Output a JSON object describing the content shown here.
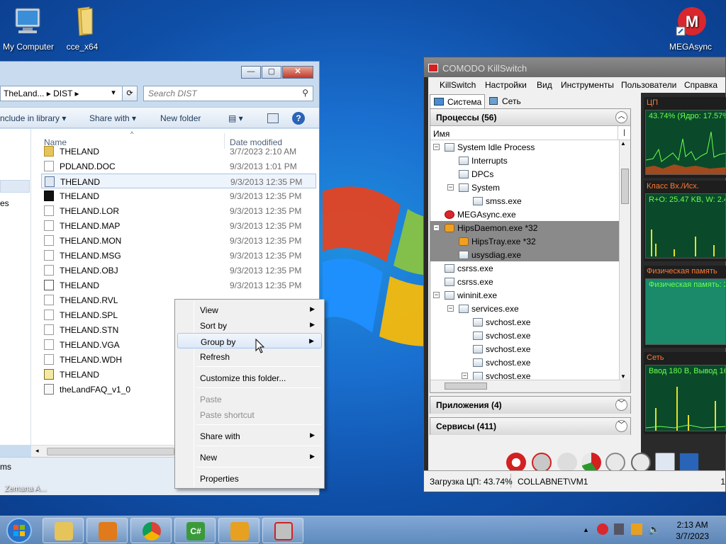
{
  "desktop": {
    "icons": [
      {
        "label": "My Computer",
        "icon": "computer-icon"
      },
      {
        "label": "cce_x64",
        "icon": "folder-icon"
      },
      {
        "label": "MEGAsync",
        "icon": "megasync-icon"
      }
    ],
    "truncated_label": "Zemana A..."
  },
  "explorer": {
    "breadcrumb": [
      "TheLand...",
      "DIST"
    ],
    "search_placeholder": "Search DIST",
    "toolbar": {
      "include": "nclude in library",
      "share": "Share with",
      "new_folder": "New folder"
    },
    "columns": {
      "name": "Name",
      "date": "Date modified"
    },
    "nav_partial": [
      "es",
      "ms"
    ],
    "files": [
      {
        "name": "THELAND",
        "date": "3/7/2023 2:10 AM",
        "icon": "folder-icon"
      },
      {
        "name": "PDLAND.DOC",
        "date": "9/3/2013 1:01 PM",
        "icon": "file-icon"
      },
      {
        "name": "THELAND",
        "date": "9/3/2013 12:35 PM",
        "icon": "app-icon"
      },
      {
        "name": "THELAND",
        "date": "9/3/2013 12:35 PM",
        "icon": "exe-icon"
      },
      {
        "name": "THELAND.LOR",
        "date": "9/3/2013 12:35 PM",
        "icon": "file-icon"
      },
      {
        "name": "THELAND.MAP",
        "date": "9/3/2013 12:35 PM",
        "icon": "file-icon"
      },
      {
        "name": "THELAND.MON",
        "date": "9/3/2013 12:35 PM",
        "icon": "file-icon"
      },
      {
        "name": "THELAND.MSG",
        "date": "9/3/2013 12:35 PM",
        "icon": "file-icon"
      },
      {
        "name": "THELAND.OBJ",
        "date": "9/3/2013 12:35 PM",
        "icon": "file-icon"
      },
      {
        "name": "THELAND",
        "date": "9/3/2013 12:35 PM",
        "icon": "shortcut-icon"
      },
      {
        "name": "THELAND.RVL",
        "date": "",
        "icon": "file-icon"
      },
      {
        "name": "THELAND.SPL",
        "date": "",
        "icon": "file-icon"
      },
      {
        "name": "THELAND.STN",
        "date": "",
        "icon": "file-icon"
      },
      {
        "name": "THELAND.VGA",
        "date": "",
        "icon": "file-icon"
      },
      {
        "name": "THELAND.WDH",
        "date": "",
        "icon": "file-icon"
      },
      {
        "name": "THELAND",
        "date": "",
        "icon": "config-icon"
      },
      {
        "name": "theLandFAQ_v1_0",
        "date": "",
        "icon": "text-file-icon"
      }
    ]
  },
  "context_menu": {
    "items": [
      "View",
      "Sort by",
      "Group by",
      "Refresh",
      "Customize this folder...",
      "Paste",
      "Paste shortcut",
      "Share with",
      "New",
      "Properties"
    ]
  },
  "killswitch": {
    "title": "COMODO KillSwitch",
    "menu": [
      "KillSwitch",
      "Настройки",
      "Вид",
      "Инструменты",
      "Пользователи",
      "Справка"
    ],
    "tabs": [
      "Система",
      "Сеть"
    ],
    "processes_header": "Процессы (56)",
    "name_column": "Имя",
    "processes": [
      "System Idle Process",
      "Interrupts",
      "DPCs",
      "System",
      "smss.exe",
      "MEGAsync.exe",
      "HipsDaemon.exe *32",
      "HipsTray.exe *32",
      "usysdiag.exe",
      "csrss.exe",
      "csrss.exe",
      "wininit.exe",
      "services.exe",
      "svchost.exe",
      "svchost.exe",
      "svchost.exe",
      "svchost.exe",
      "svchost.exe"
    ],
    "apps_header": "Приложения (4)",
    "services_header": "Сервисы (411)",
    "graphs": [
      {
        "title": "ЦП",
        "value": "43.74% (Ядро: 17.57%"
      },
      {
        "title": "Класс Вх./Исх.",
        "value": "R+O: 25.47 KB, W: 2.4"
      },
      {
        "title": "Физическая память",
        "value": "Физическая память: 2"
      },
      {
        "title": "Сеть",
        "value": "Ввод 180 В, Вывод 16"
      }
    ],
    "status_cpu": "Загрузка ЦП: 43.74%",
    "status_user": "COLLABNET\\VM1",
    "status_edge": "1"
  },
  "taskbar": {
    "time": "2:13 AM",
    "date": "3/7/2023"
  },
  "colors": {
    "accent": "#1a6fcf",
    "comodo_red": "#d42020"
  }
}
